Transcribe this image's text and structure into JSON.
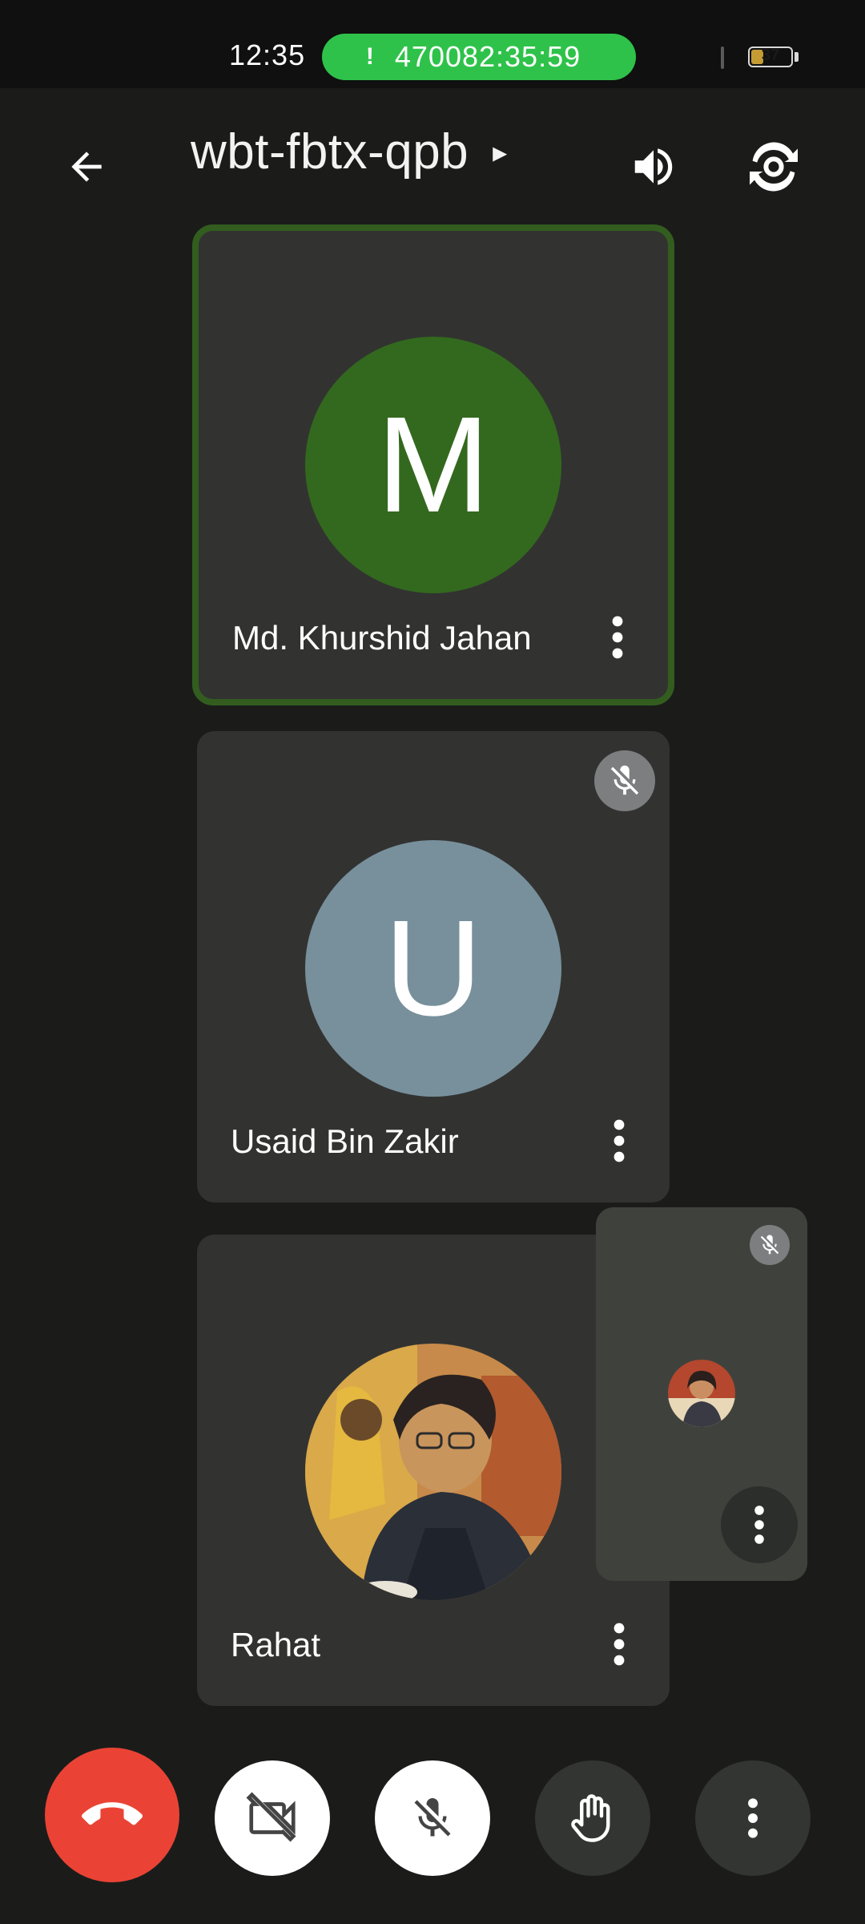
{
  "status_bar": {
    "time": "12:35",
    "call_indicator_icon": "!",
    "call_timer": "470082:35:59",
    "battery_level": "37",
    "battery_fraction": 0.37
  },
  "header": {
    "meeting_code": "wbt-fbtx-qpb",
    "caret": "▸"
  },
  "participants": [
    {
      "name": "Md. Khurshid Jahan",
      "initial": "M",
      "avatar_color": "#33691e",
      "speaking": true,
      "muted": false
    },
    {
      "name": "Usaid Bin Zakir",
      "initial": "U",
      "avatar_color": "#78909c",
      "speaking": false,
      "muted": true
    },
    {
      "name": "Rahat",
      "initial": "",
      "avatar_color": "#8a6a3a",
      "speaking": false,
      "muted": true,
      "has_photo": true
    }
  ],
  "self_view": {
    "muted": true
  },
  "colors": {
    "end_call": "#ea4335",
    "call_pill": "#2fc24a",
    "active_border": "#325d1f"
  },
  "icons": {
    "back": "arrow-left-icon",
    "speaker": "speaker-icon",
    "switch_camera": "switch-camera-icon",
    "end_call": "phone-hangup-icon",
    "camera_off": "video-off-icon",
    "mic_off": "mic-off-icon",
    "raise_hand": "hand-icon",
    "more": "more-vert-icon"
  }
}
